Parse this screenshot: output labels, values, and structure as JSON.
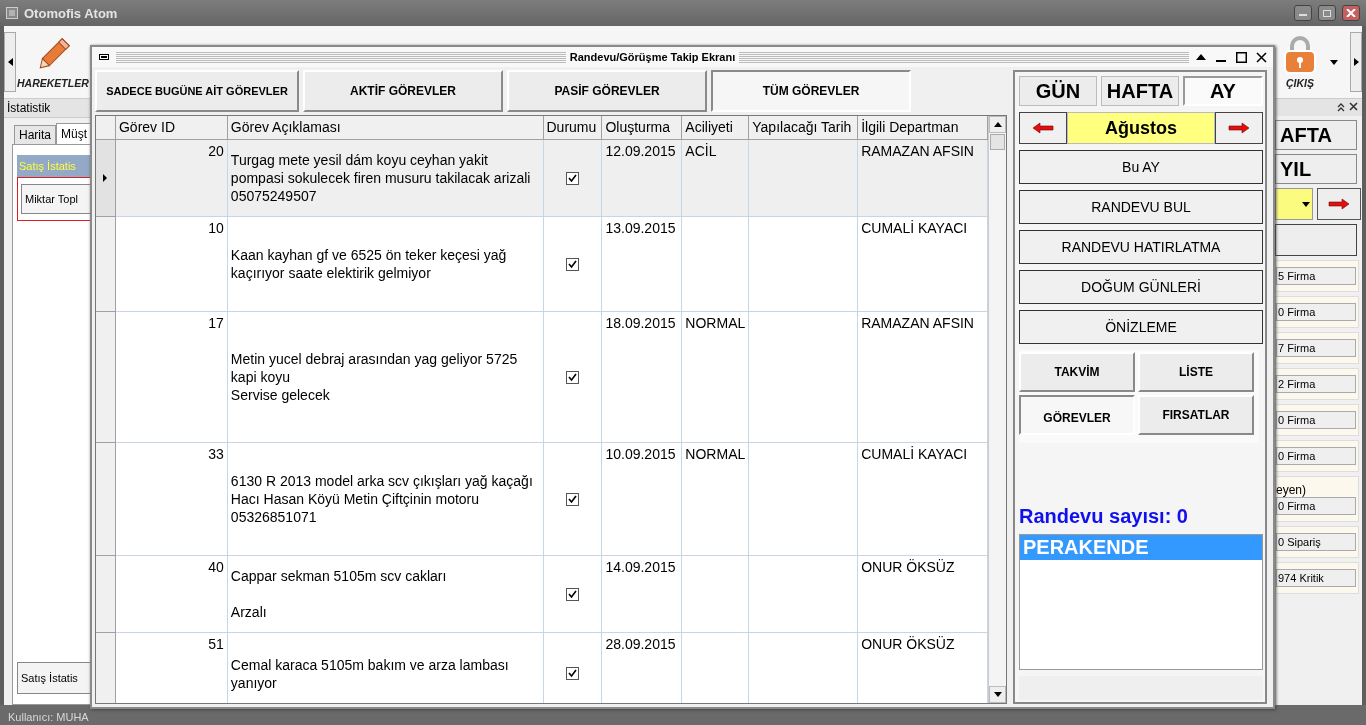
{
  "window": {
    "title": "Otomofis Atom"
  },
  "toolbar": {
    "items": [
      {
        "label": "HAREKETLER",
        "kind": "pencil"
      },
      {
        "label": "ÇIKIŞ",
        "kind": "lock"
      }
    ]
  },
  "left_panel": {
    "title": "İstatistik",
    "tabs": [
      {
        "label": "Harita",
        "selected": false
      },
      {
        "label": "Müşt",
        "selected": true
      }
    ],
    "section_title": "Satış İstatis",
    "field": "Miktar Topl",
    "bottom_tab": "Satış İstatis"
  },
  "right_panel": {
    "buttons": [
      "AFTA",
      "YIL"
    ],
    "cards": [
      {
        "value": "5 Firma"
      },
      {
        "value": "0 Firma"
      },
      {
        "value": "7 Firma"
      },
      {
        "value": "2 Firma"
      },
      {
        "value": "0 Firma"
      },
      {
        "value": "0 Firma"
      },
      {
        "legend": "eyen)",
        "value": "0 Firma"
      },
      {
        "value": "0 Sipariş"
      },
      {
        "value": "974 Kritik"
      }
    ]
  },
  "status_bar": {
    "user": "Kullanıcı: MUHA"
  },
  "dialog": {
    "title": "Randevu/Görüşme Takip Ekranı",
    "filter_tabs": [
      {
        "label": "SADECE BUGÜNE AİT GÖREVLER",
        "selected": false
      },
      {
        "label": "AKTİF GÖREVLER",
        "selected": false
      },
      {
        "label": "PASİF GÖREVLER",
        "selected": false
      },
      {
        "label": "TÜM GÖREVLER",
        "selected": true
      }
    ],
    "table": {
      "columns": [
        "Görev ID",
        "Görev Açıklaması",
        "Durumu",
        "Oluşturma",
        "Aciliyeti",
        "Yapılacağı Tarih",
        "İlgili Departman"
      ],
      "rows": [
        {
          "id": "20",
          "description": "Turgag mete yesil dám koyu ceyhan yakit pompasi sokulecek firen musuru takilacak arizali 05075249507",
          "done": true,
          "created": "12.09.2015",
          "urgency": "ACİL",
          "department": "RAMAZAN AFSIN",
          "selected": true
        },
        {
          "id": "10",
          "description": "Kaan kayhan gf ve 6525 ön teker keçesi yağ kaçırıyor saate elektirik gelmiyor",
          "done": true,
          "created": "13.09.2015",
          "department": "CUMALİ KAYACI",
          "selected": false
        },
        {
          "id": "17",
          "description": "Metin yucel debraj arasından yag geliyor 5725 kapi koyu\nServise gelecek",
          "done": true,
          "created": "18.09.2015",
          "urgency": "NORMAL",
          "department": "RAMAZAN AFSIN",
          "selected": false
        },
        {
          "id": "33",
          "description": "6130 R 2013 model arka scv çıkışları yağ kaçağı\nHacı Hasan Köyü Metin Çiftçinin motoru\n05326851071",
          "done": true,
          "created": "10.09.2015",
          "urgency": "NORMAL",
          "department": "CUMALİ KAYACI",
          "selected": false
        },
        {
          "id": "40",
          "description": "Cappar sekman 5105m scv cakları\n\nArzalı",
          "done": true,
          "created": "14.09.2015",
          "department": "ONUR ÖKSÜZ",
          "selected": false
        },
        {
          "id": "51",
          "description": "Cemal karaca 5105m bakım ve arza lambası yanıyor",
          "done": true,
          "created": "28.09.2015",
          "department": "ONUR ÖKSÜZ",
          "selected": false
        }
      ]
    },
    "side": {
      "views": [
        {
          "label": "GÜN",
          "selected": false
        },
        {
          "label": "HAFTA",
          "selected": false
        },
        {
          "label": "AY",
          "selected": true
        }
      ],
      "month": "Ağustos",
      "actions": [
        "Bu AY",
        "RANDEVU BUL",
        "RANDEVU HATIRLATMA",
        "DOĞUM GÜNLERİ",
        "ÖNİZLEME"
      ],
      "modes": [
        {
          "label": "TAKVİM",
          "selected": false
        },
        {
          "label": "LİSTE",
          "selected": false
        },
        {
          "label": "GÖREVLER",
          "selected": true
        },
        {
          "label": "FIRSATLAR",
          "selected": false
        }
      ],
      "count": "Randevu sayısı: 0",
      "list": [
        {
          "label": "PERAKENDE",
          "selected": true
        }
      ]
    }
  }
}
